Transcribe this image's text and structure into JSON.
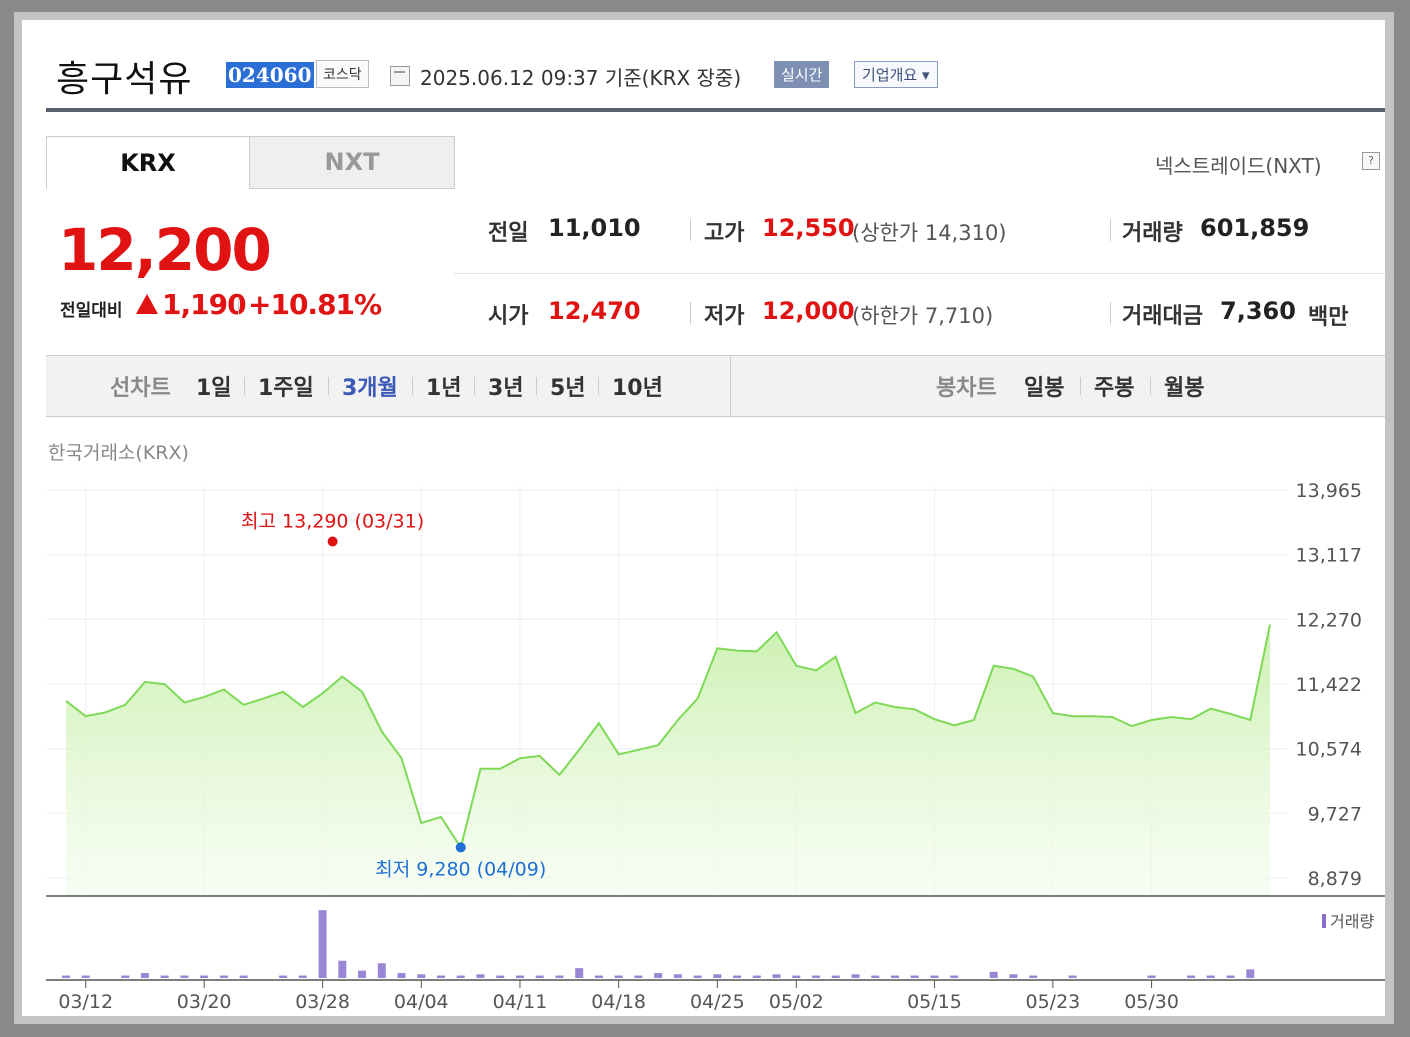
{
  "header": {
    "company_name": "흥구석유",
    "stock_code": "024060",
    "market": "코스닥",
    "datetime": "2025.06.12 09:37  기준(KRX 장중)",
    "realtime_label": "실시간",
    "company_info_label": "기업개요 ▾"
  },
  "tabs": [
    {
      "label": "KRX",
      "active": true
    },
    {
      "label": "NXT",
      "active": false
    }
  ],
  "nextrade_label": "넥스트레이드(NXT)",
  "help_icon": "question-icon",
  "price": {
    "current": "12,200",
    "compare_label": "전일대비",
    "change": "1,190",
    "change_pct": "+10.81%",
    "direction": "up",
    "color": "#e01212"
  },
  "stats": {
    "prev_close": {
      "label": "전일",
      "value": "11,010"
    },
    "open": {
      "label": "시가",
      "value": "12,470"
    },
    "high": {
      "label": "고가",
      "value": "12,550",
      "limit": "(상한가 14,310)"
    },
    "low": {
      "label": "저가",
      "value": "12,000",
      "limit": "(하한가 7,710)"
    },
    "volume": {
      "label": "거래량",
      "value": "601,859"
    },
    "amount": {
      "label": "거래대금",
      "value": "7,360",
      "unit": "백만"
    }
  },
  "range_bar": {
    "line_chart_label": "선차트",
    "ranges": [
      "1일",
      "1주일",
      "3개월",
      "1년",
      "3년",
      "5년",
      "10년"
    ],
    "selected": "3개월",
    "candle_label": "봉차트",
    "candles": [
      "일봉",
      "주봉",
      "월봉"
    ]
  },
  "exchange_label": "한국거래소(KRX)",
  "chart_data": {
    "type": "area",
    "y_ticks": [
      "13,965",
      "13,117",
      "12,270",
      "11,422",
      "10,574",
      "9,727",
      "8,879"
    ],
    "ylim": [
      8879,
      13965
    ],
    "x_ticks": [
      "03/12",
      "03/20",
      "03/28",
      "04/04",
      "04/11",
      "04/18",
      "04/25",
      "05/02",
      "05/15",
      "05/23",
      "05/30"
    ],
    "series": [
      {
        "values": [
          11200,
          11000,
          11050,
          11150,
          11450,
          11420,
          11180,
          11250,
          11350,
          11150,
          11230,
          11320,
          11120,
          11300,
          11520,
          11320,
          10800,
          10450,
          9600,
          9680,
          9280,
          10310,
          10310,
          10450,
          10480,
          10230,
          10560,
          10910,
          10500,
          10560,
          10620,
          10950,
          11230,
          11890,
          11860,
          11850,
          12100,
          11660,
          11600,
          11780,
          11040,
          11180,
          11120,
          11090,
          10960,
          10880,
          10950,
          11660,
          11620,
          11520,
          11040,
          11000,
          11000,
          10990,
          10870,
          10950,
          10990,
          10960,
          11100,
          11030,
          10950,
          12200
        ],
        "color": "#7ed957"
      }
    ],
    "max_annotation": "최고 13,290 (03/31)",
    "min_annotation": "최저 9,280 (04/09)",
    "max_value": 13290,
    "min_value": 9280,
    "volume_legend": "거래량",
    "volume": [
      2,
      2,
      0,
      2,
      4,
      2,
      2,
      2,
      2,
      2,
      0,
      2,
      2,
      55,
      14,
      6,
      12,
      4,
      3,
      2,
      2,
      3,
      2,
      2,
      2,
      2,
      8,
      2,
      2,
      2,
      4,
      3,
      2,
      3,
      2,
      2,
      3,
      2,
      2,
      2,
      3,
      2,
      2,
      2,
      2,
      2,
      0,
      5,
      3,
      2,
      0,
      2,
      0,
      0,
      0,
      2,
      0,
      2,
      2,
      2,
      7
    ],
    "grid": true
  }
}
